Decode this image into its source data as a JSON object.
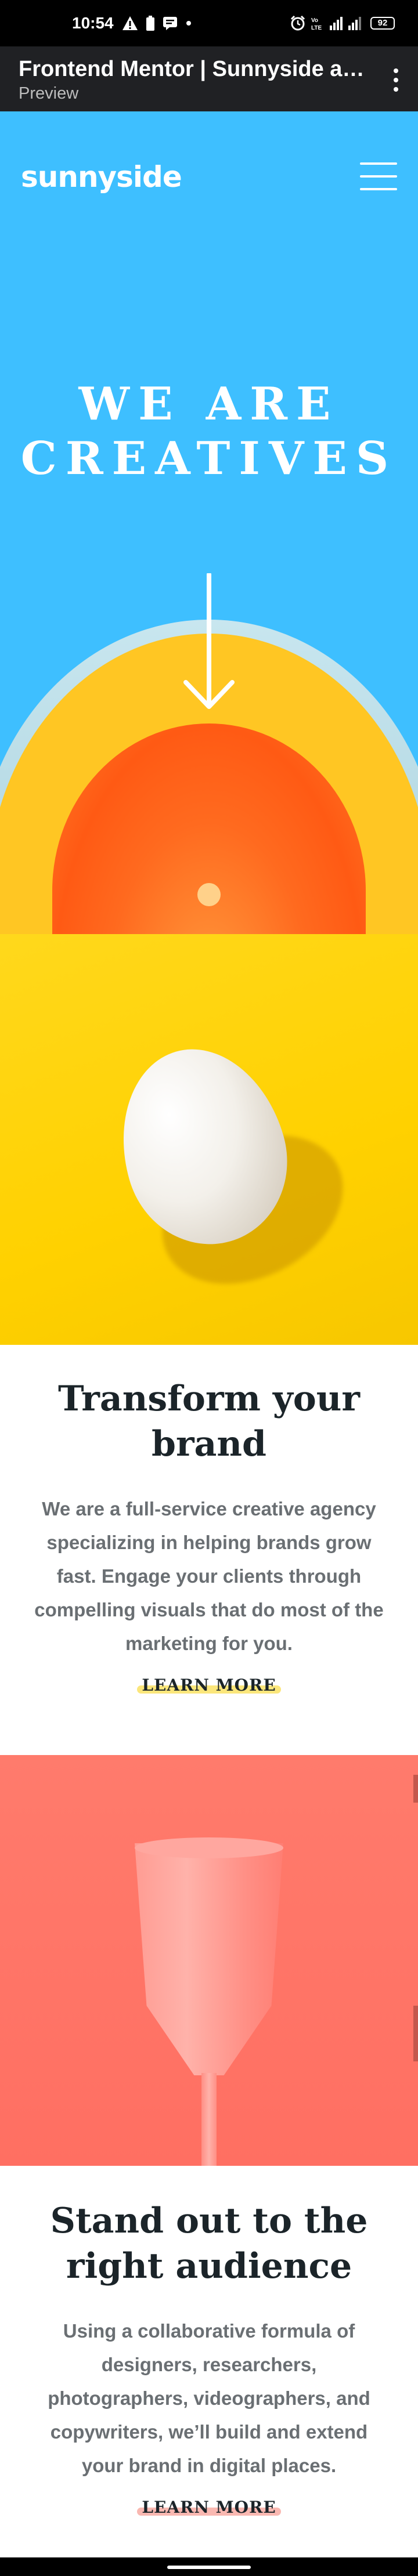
{
  "status_bar": {
    "time": "10:54",
    "battery": "92",
    "icons": [
      "warning-icon",
      "battery-saver-icon",
      "notification-icon",
      "dot-icon",
      "alarm-icon",
      "volte-icon",
      "signal-icon"
    ]
  },
  "browser": {
    "title": "Frontend Mentor | Sunnyside ag…",
    "subtitle": "Preview",
    "menu_icon": "more-vert-icon",
    "toolbar_color": "#202124"
  },
  "hero": {
    "logo": "sunnyside",
    "title_line1": "WE ARE",
    "title_line2": "CREATIVES",
    "menu_icon": "hamburger-icon",
    "arrow_icon": "arrow-down-icon",
    "background_color": "#3ebfff"
  },
  "sections": [
    {
      "image_icon": "egg-image",
      "title": "Transform your brand",
      "body": "We are a full-service creative agency specializing in helping brands grow fast. Engage your clients through compelling visuals that do most of the marketing for you.",
      "link": "LEARN MORE",
      "highlight_color": "#fbe67b"
    },
    {
      "image_icon": "glass-image",
      "title": "Stand out to the right audience",
      "body": "Using a collaborative formula of designers, researchers, photographers, videographers, and copywriters, we’ll build and extend your brand in digital places.",
      "link": "LEARN MORE",
      "highlight_color": "#f9b8b1"
    }
  ]
}
